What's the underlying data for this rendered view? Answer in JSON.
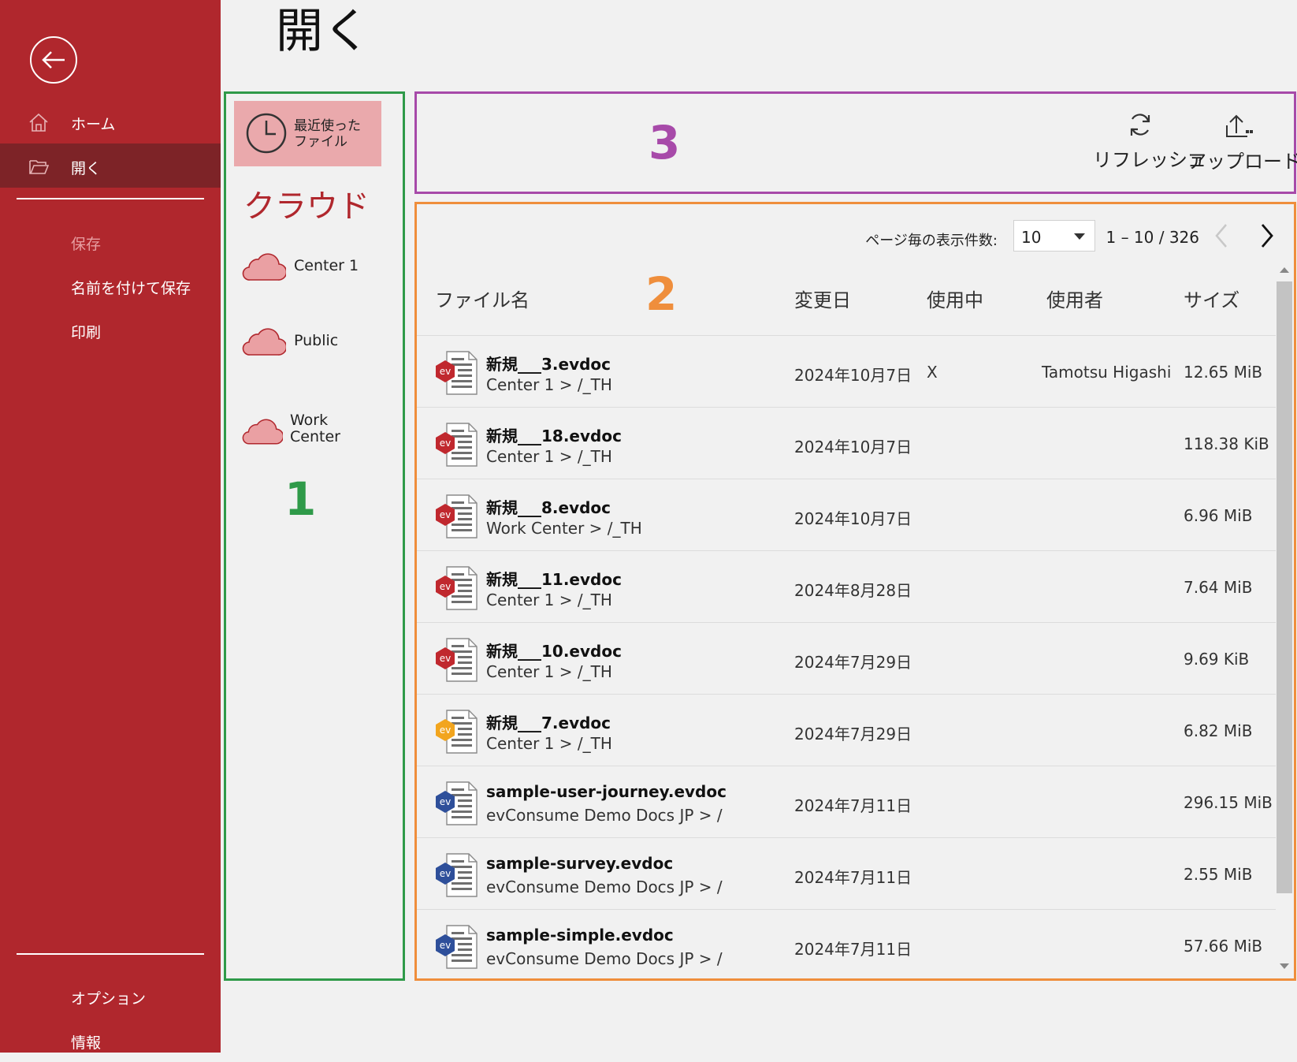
{
  "title": "開く",
  "sidebar": {
    "items": [
      {
        "label": "ホーム"
      },
      {
        "label": "開く"
      },
      {
        "label": "保存"
      },
      {
        "label": "名前を付けて保存"
      },
      {
        "label": "印刷"
      },
      {
        "label": "オプション"
      },
      {
        "label": "情報"
      }
    ]
  },
  "locations": {
    "recent_label": "最近使ったファイル",
    "section_heading": "クラウド",
    "items": [
      {
        "label": "Center 1"
      },
      {
        "label": "Public"
      },
      {
        "label": "Work Center"
      }
    ]
  },
  "annotations": {
    "one": "1",
    "two": "2",
    "three": "3",
    "colors": {
      "one": "#2f9a49",
      "two": "#ef8e3c",
      "three": "#a74aa9"
    }
  },
  "toolbar": {
    "refresh_label": "リフレッシュ",
    "upload_label": "アップロード"
  },
  "pager": {
    "per_page_label": "ページ毎の表示件数:",
    "per_page_value": "10",
    "range": "1 – 10 / 326"
  },
  "table": {
    "headers": {
      "name": "ファイル名",
      "date": "変更日",
      "in_use": "使用中",
      "user": "使用者",
      "size": "サイズ"
    },
    "rows": [
      {
        "name": "新規___3.evdoc",
        "path": "Center 1 > /_TH",
        "date": "2024年10月7日",
        "in_use": "X",
        "user": "Tamotsu Higashi",
        "size": "12.65 MiB",
        "badge_color": "#c0282e"
      },
      {
        "name": "新規___18.evdoc",
        "path": "Center 1 > /_TH",
        "date": "2024年10月7日",
        "in_use": "",
        "user": "",
        "size": "118.38 KiB",
        "badge_color": "#c0282e"
      },
      {
        "name": "新規___8.evdoc",
        "path": "Work Center > /_TH",
        "date": "2024年10月7日",
        "in_use": "",
        "user": "",
        "size": "6.96 MiB",
        "badge_color": "#c0282e"
      },
      {
        "name": "新規___11.evdoc",
        "path": "Center 1 > /_TH",
        "date": "2024年8月28日",
        "in_use": "",
        "user": "",
        "size": "7.64 MiB",
        "badge_color": "#c0282e"
      },
      {
        "name": "新規___10.evdoc",
        "path": "Center 1 > /_TH",
        "date": "2024年7月29日",
        "in_use": "",
        "user": "",
        "size": "9.69 KiB",
        "badge_color": "#c0282e"
      },
      {
        "name": "新規___7.evdoc",
        "path": "Center 1 > /_TH",
        "date": "2024年7月29日",
        "in_use": "",
        "user": "",
        "size": "6.82 MiB",
        "badge_color": "#f2a51e"
      },
      {
        "name": "sample-user-journey.evdoc",
        "path": "evConsume Demo Docs JP > /",
        "date": "2024年7月11日",
        "in_use": "",
        "user": "",
        "size": "296.15 MiB",
        "badge_color": "#2e4f9a"
      },
      {
        "name": "sample-survey.evdoc",
        "path": "evConsume Demo Docs JP > /",
        "date": "2024年7月11日",
        "in_use": "",
        "user": "",
        "size": "2.55 MiB",
        "badge_color": "#2e4f9a"
      },
      {
        "name": "sample-simple.evdoc",
        "path": "evConsume Demo Docs JP > /",
        "date": "2024年7月11日",
        "in_use": "",
        "user": "",
        "size": "57.66 MiB",
        "badge_color": "#2e4f9a"
      }
    ]
  }
}
